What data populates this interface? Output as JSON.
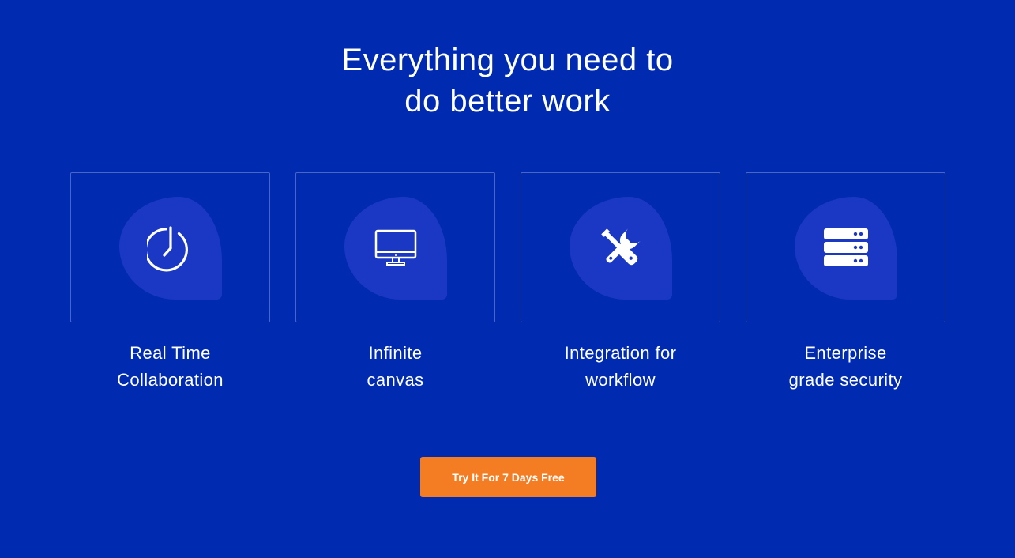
{
  "heading": {
    "line1": "Everything you need to",
    "line2": "do better work"
  },
  "features": [
    {
      "line1": "Real Time",
      "line2": "Collaboration",
      "icon": "clock-icon"
    },
    {
      "line1": "Infinite",
      "line2": "canvas",
      "icon": "monitor-icon"
    },
    {
      "line1": "Integration for",
      "line2": "workflow",
      "icon": "tools-icon"
    },
    {
      "line1": "Enterprise",
      "line2": "grade security",
      "icon": "server-icon"
    }
  ],
  "cta": {
    "label": "Try It For 7 Days Free"
  },
  "colors": {
    "background": "#002bb0",
    "card_blob": "#1a38c4",
    "cta": "#f47c22",
    "text": "#ffffff"
  }
}
